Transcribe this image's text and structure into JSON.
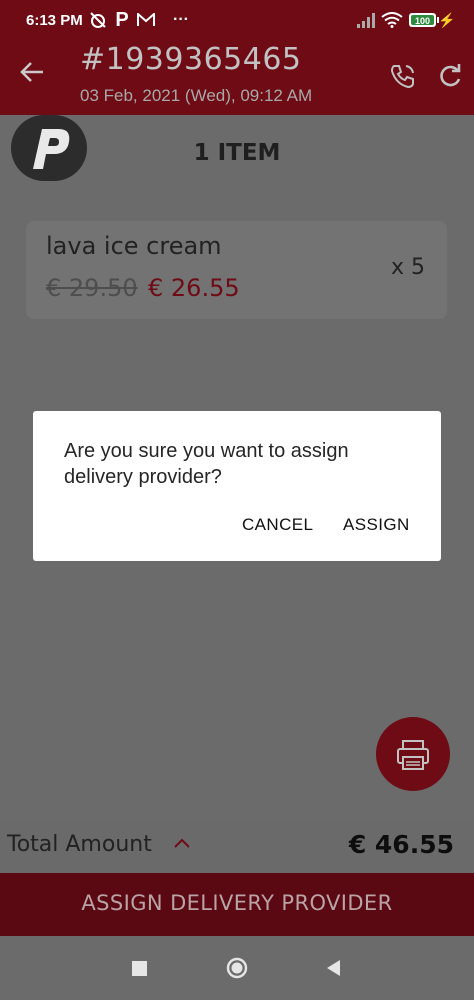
{
  "status_bar": {
    "time": "6:13 PM",
    "left_icons": [
      "alarm-off-icon",
      "p-app-icon",
      "gmail-icon",
      "more-dots-icon"
    ],
    "right_icons": [
      "signal-icon",
      "wifi-icon",
      "battery-icon",
      "charging-icon"
    ],
    "battery": "100"
  },
  "header": {
    "order_number": "#1939365465",
    "order_date": "03 Feb, 2021 (Wed), 09:12 AM"
  },
  "item_count": "1 ITEM",
  "items": [
    {
      "name": "lava ice cream",
      "old_price": "€ 29.50",
      "new_price": "€ 26.55",
      "qty": "x 5"
    }
  ],
  "dialog": {
    "message": "Are you sure you want to assign delivery provider?",
    "cancel": "CANCEL",
    "assign": "ASSIGN"
  },
  "total": {
    "label": "Total Amount",
    "amount": "€ 46.55"
  },
  "assign_button": "ASSIGN DELIVERY PROVIDER",
  "colors": {
    "brand": "#6e0b15",
    "overlay_bg": "#6b6b6b",
    "dialog_bg": "#ffffff"
  }
}
